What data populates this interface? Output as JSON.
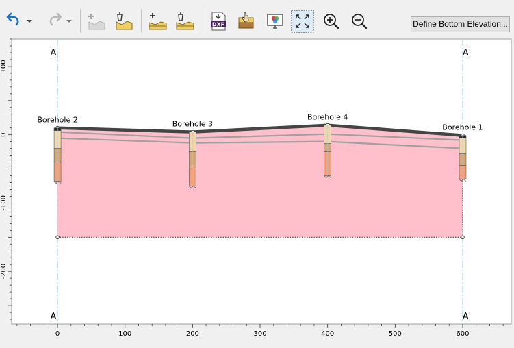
{
  "toolbar": {
    "buttons": [
      {
        "name": "undo-button",
        "icon": "undo-icon",
        "dropdown": true
      },
      {
        "name": "redo-button",
        "icon": "redo-icon",
        "dropdown": true
      },
      {
        "name": "add-boundary-button",
        "icon": "add-boundary-icon"
      },
      {
        "name": "delete-boundary-button",
        "icon": "delete-boundary-icon"
      },
      {
        "name": "add-layer-button",
        "icon": "add-layer-icon"
      },
      {
        "name": "delete-layer-button",
        "icon": "delete-layer-icon"
      },
      {
        "name": "export-dxf-button",
        "icon": "dxf-export-icon",
        "text": "DXF"
      },
      {
        "name": "layer-material-button",
        "icon": "layer-material-icon"
      },
      {
        "name": "display-options-button",
        "icon": "display-options-icon"
      },
      {
        "name": "zoom-extents-button",
        "icon": "zoom-extents-icon"
      },
      {
        "name": "zoom-in-button",
        "icon": "zoom-in-icon"
      },
      {
        "name": "zoom-out-button",
        "icon": "zoom-out-icon"
      }
    ],
    "define_bottom_label": "Define Bottom Elevation..."
  },
  "section": {
    "start_label": "A",
    "end_label": "A'"
  },
  "chart_data": {
    "type": "cross-section",
    "x_ticks": [
      0,
      100,
      200,
      300,
      400,
      500,
      600
    ],
    "y_ticks": [
      100,
      0,
      -100,
      -200
    ],
    "xlim": [
      -68,
      672
    ],
    "ylim": [
      -277,
      140
    ],
    "bottom_elevation": -150,
    "ground_surface": [
      [
        0,
        10
      ],
      [
        200,
        4
      ],
      [
        400,
        14
      ],
      [
        600,
        -1
      ]
    ],
    "layer_boundary_lines": [
      [
        [
          0,
          -5
        ],
        [
          200,
          -12
        ],
        [
          400,
          -10
        ],
        [
          600,
          -20
        ]
      ],
      [
        [
          0,
          4
        ],
        [
          200,
          -5
        ],
        [
          400,
          1
        ],
        [
          600,
          -8
        ]
      ]
    ],
    "boreholes": [
      {
        "name": "Borehole 2",
        "x": 0,
        "top": 10,
        "bottom": -68,
        "layers": [
          {
            "top": 10,
            "bottom": 6,
            "color": "#2b2b2b"
          },
          {
            "top": 6,
            "bottom": -20,
            "color": "#f2d8ad"
          },
          {
            "top": -20,
            "bottom": -40,
            "color": "#d4a878"
          },
          {
            "top": -40,
            "bottom": -68,
            "color": "#f4a07a"
          }
        ]
      },
      {
        "name": "Borehole 3",
        "x": 200,
        "top": 4,
        "bottom": -75,
        "layers": [
          {
            "top": 4,
            "bottom": -25,
            "color": "#f2d8ad"
          },
          {
            "top": -25,
            "bottom": -46,
            "color": "#d4a878"
          },
          {
            "top": -46,
            "bottom": -75,
            "color": "#f4a07a"
          }
        ]
      },
      {
        "name": "Borehole 4",
        "x": 400,
        "top": 14,
        "bottom": -60,
        "layers": [
          {
            "top": 14,
            "bottom": -13,
            "color": "#f2d8ad"
          },
          {
            "top": -13,
            "bottom": -25,
            "color": "#d4a878"
          },
          {
            "top": -25,
            "bottom": -60,
            "color": "#f4a07a"
          }
        ]
      },
      {
        "name": "Borehole 1",
        "x": 600,
        "top": -1,
        "bottom": -65,
        "layers": [
          {
            "top": -1,
            "bottom": -5,
            "color": "#2b2b2b"
          },
          {
            "top": -5,
            "bottom": -28,
            "color": "#f2d8ad"
          },
          {
            "top": -28,
            "bottom": -45,
            "color": "#d4a878"
          },
          {
            "top": -45,
            "bottom": -65,
            "color": "#f4a07a"
          }
        ]
      }
    ]
  },
  "colors": {
    "soil_fill": "#ffc0cb",
    "ground_line": "#444444",
    "layer_line": "#a0a0a0",
    "section_line": "#9ccbe0"
  }
}
